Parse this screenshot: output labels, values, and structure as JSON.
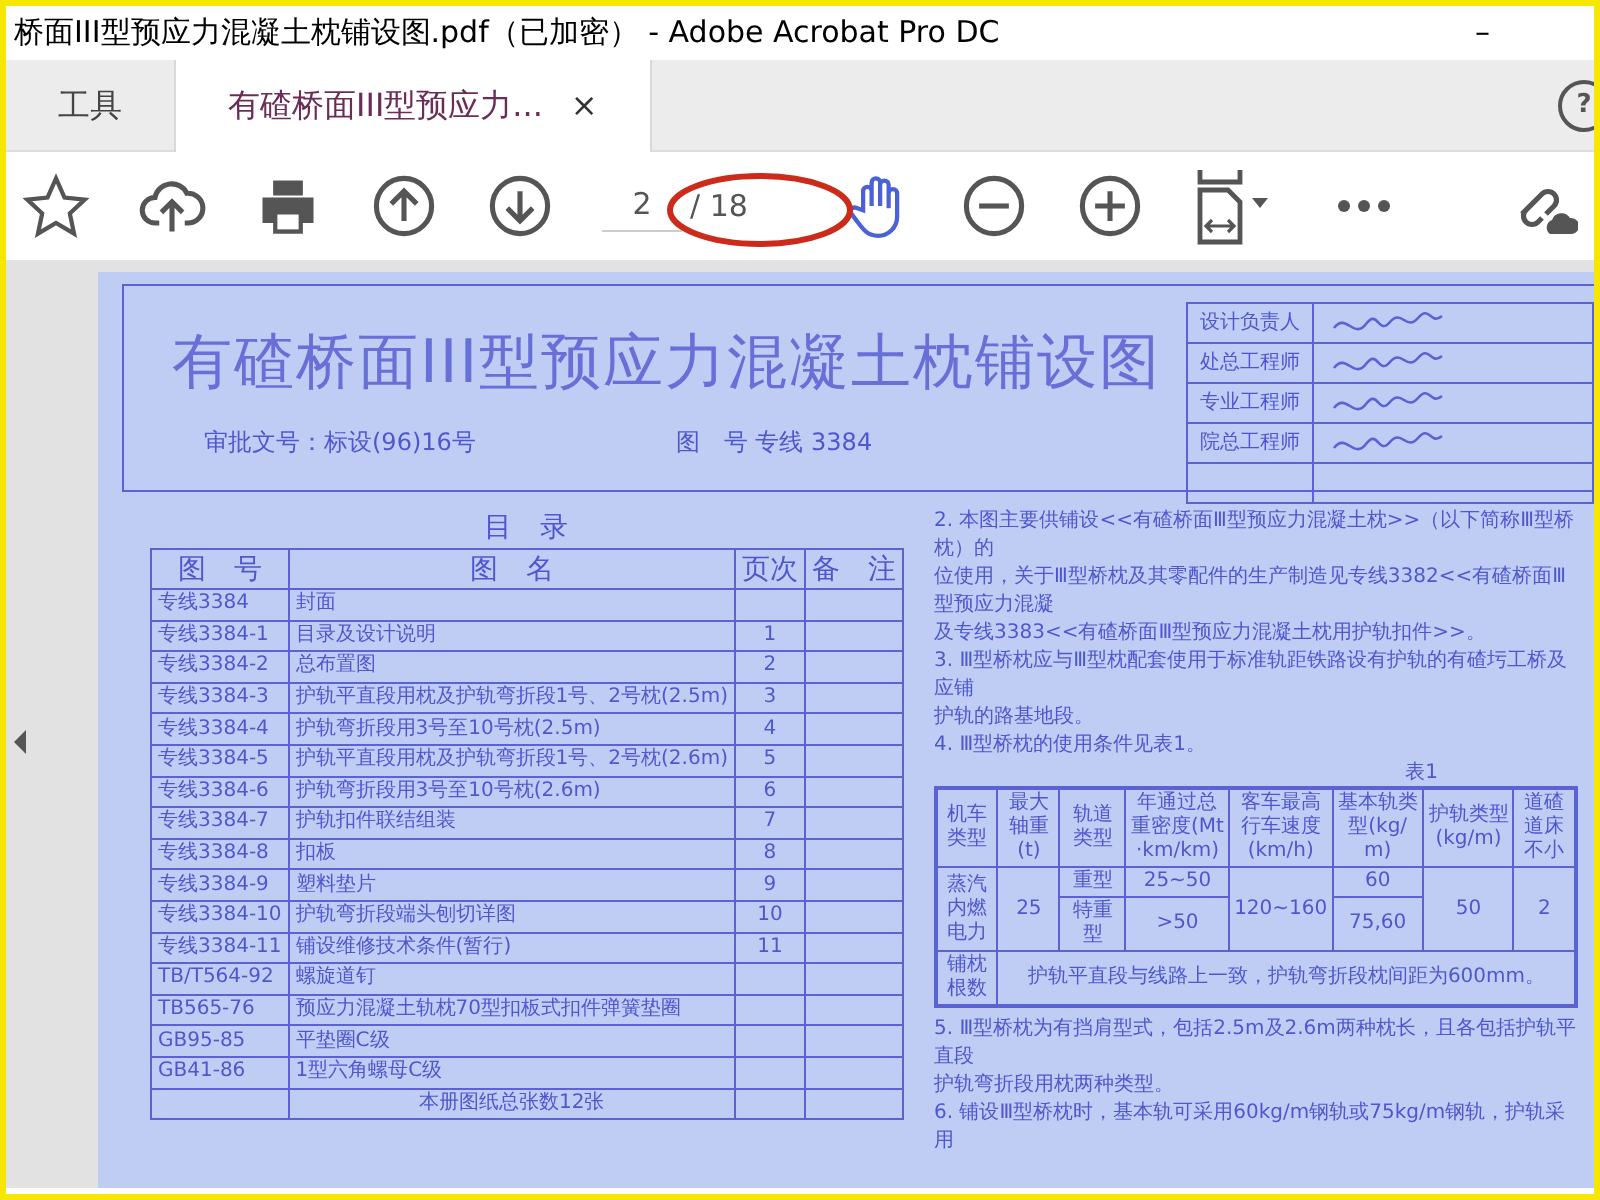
{
  "window": {
    "title": "桥面III型预应力混凝土枕铺设图.pdf（已加密） - Adobe Acrobat Pro DC",
    "minimize": "–"
  },
  "tabs": [
    {
      "label": "工具",
      "selected": false,
      "closable": false
    },
    {
      "label": "有碴桥面III型预应力...",
      "selected": true,
      "closable": true
    }
  ],
  "tab_close": "×",
  "help": "?",
  "toolbar": {
    "page_value": "2",
    "page_total": "/ 18"
  },
  "document": {
    "title": "有碴桥面III型预应力混凝土枕铺设图",
    "approval": "审批文号：标设(96)16号",
    "drawing_number": "图　号 专线 3384",
    "sign_roles": [
      "设计负责人",
      "处总工程师",
      "专业工程师",
      "院总工程师"
    ],
    "toc_title": "目　录",
    "toc_columns": [
      "图　号",
      "图　名",
      "页次",
      "备　注"
    ],
    "toc_rows": [
      {
        "code": "专线3384",
        "name": "封面",
        "page": ""
      },
      {
        "code": "专线3384-1",
        "name": "目录及设计说明",
        "page": "1"
      },
      {
        "code": "专线3384-2",
        "name": "总布置图",
        "page": "2"
      },
      {
        "code": "专线3384-3",
        "name": "护轨平直段用枕及护轨弯折段1号、2号枕(2.5m)",
        "page": "3"
      },
      {
        "code": "专线3384-4",
        "name": "护轨弯折段用3号至10号枕(2.5m)",
        "page": "4"
      },
      {
        "code": "专线3384-5",
        "name": "护轨平直段用枕及护轨弯折段1号、2号枕(2.6m)",
        "page": "5"
      },
      {
        "code": "专线3384-6",
        "name": "护轨弯折段用3号至10号枕(2.6m)",
        "page": "6"
      },
      {
        "code": "专线3384-7",
        "name": "护轨扣件联结组装",
        "page": "7"
      },
      {
        "code": "专线3384-8",
        "name": "扣板",
        "page": "8"
      },
      {
        "code": "专线3384-9",
        "name": "塑料垫片",
        "page": "9"
      },
      {
        "code": "专线3384-10",
        "name": "护轨弯折段端头刨切详图",
        "page": "10"
      },
      {
        "code": "专线3384-11",
        "name": "铺设维修技术条件(暂行)",
        "page": "11"
      },
      {
        "code": "TB/T564-92",
        "name": "螺旋道钉",
        "page": ""
      },
      {
        "code": "TB565-76",
        "name": "预应力混凝土轨枕70型扣板式扣件弹簧垫圈",
        "page": ""
      },
      {
        "code": "GB95-85",
        "name": "平垫圈C级",
        "page": ""
      },
      {
        "code": "GB41-86",
        "name": "1型六角螺母C级",
        "page": ""
      }
    ],
    "toc_total": "本册图纸总张数12张",
    "paragraphs_top": [
      "2. 本图主要供铺设<<有碴桥面Ⅲ型预应力混凝土枕>>（以下简称Ⅲ型桥枕）的",
      "位使用，关于Ⅲ型桥枕及其零配件的生产制造见专线3382<<有碴桥面Ⅲ型预应力混凝",
      "及专线3383<<有碴桥面Ⅲ型预应力混凝土枕用护轨扣件>>。",
      "3. Ⅲ型桥枕应与Ⅲ型枕配套使用于标准轨距铁路设有护轨的有碴圬工桥及应铺",
      "护轨的路基地段。",
      "4. Ⅲ型桥枕的使用条件见表1。"
    ],
    "table1": {
      "caption": "表1",
      "headers": [
        "机车类型",
        "最大轴重(t)",
        "轨道类型",
        "年通过总重密度(Mt·km/km)",
        "客车最高行车速度(km/h)",
        "基本轨类型(kg/m)",
        "护轨类型(kg/m)",
        "道碴道床不小"
      ],
      "locomotive": "蒸汽内燃电力",
      "axle": "25",
      "rows": [
        {
          "track": "重型",
          "density": "25~50",
          "rail": "60"
        },
        {
          "track": "特重型",
          "density": ">50",
          "rail": "75,60"
        }
      ],
      "speed": "120~160",
      "guard": "50",
      "ballast": "2",
      "count_label": "铺枕根数",
      "count_text": "护轨平直段与线路上一致，护轨弯折段枕间距为600mm。"
    },
    "paragraphs_bottom": [
      "5. Ⅲ型桥枕为有挡肩型式，包括2.5m及2.6m两种枕长，且各包括护轨平直段",
      "护轨弯折段用枕两种类型。",
      "6. 铺设Ⅲ型桥枕时，基本轨可采用60kg/m钢轨或75kg/m钢轨，护轨采用"
    ]
  }
}
